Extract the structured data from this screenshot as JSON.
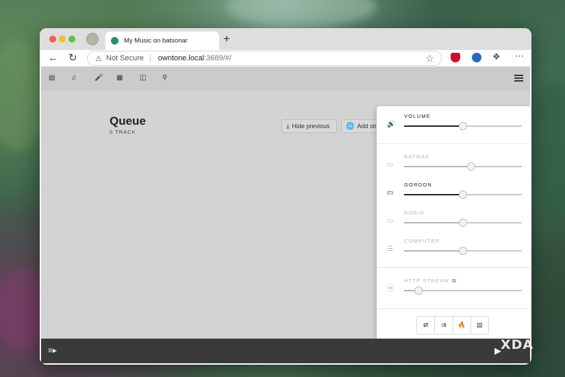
{
  "browser": {
    "tab_title": "My Music on batsonar",
    "new_tab_symbol": "+",
    "not_secure": "Not Secure",
    "url_host": "owntone.local",
    "url_rest": ":3689/#/",
    "url_separator": "|"
  },
  "app_nav": {
    "icons": [
      "music-library-icon",
      "music-note-icon",
      "microphone-icon",
      "book-icon",
      "folder-icon",
      "search-icon"
    ]
  },
  "queue": {
    "title": "Queue",
    "count_label": "0 TRACK",
    "hide_previous_label": "Hide previous",
    "add_stream_label": "Add stream"
  },
  "outputs": {
    "volume": {
      "label": "VOLUME",
      "level": 0.5,
      "active": true,
      "icon": "speaker-volume-icon"
    },
    "devices": [
      {
        "label": "BATMAC",
        "level": 0.57,
        "active": false,
        "icon": "monitor-icon"
      },
      {
        "label": "GORDON",
        "level": 0.5,
        "active": true,
        "icon": "airplay-icon"
      },
      {
        "label": "ROBIN",
        "level": 0.5,
        "active": false,
        "icon": "monitor-icon"
      },
      {
        "label": "COMPUTER",
        "level": 0.5,
        "active": false,
        "icon": "server-icon"
      }
    ],
    "http_stream": {
      "label": "HTTP STREAM",
      "level": 0.12,
      "active": false,
      "icon": "broadcast-icon"
    }
  },
  "playback_modes": [
    "shuffle-icon",
    "repeat-icon",
    "consume-icon",
    "lyrics-icon"
  ],
  "watermark": "XDA",
  "colors": {
    "active": "#222222",
    "inactive": "#b5b5b5",
    "link_blue": "#4a6fd1",
    "player_bar": "#3a3a3a"
  }
}
